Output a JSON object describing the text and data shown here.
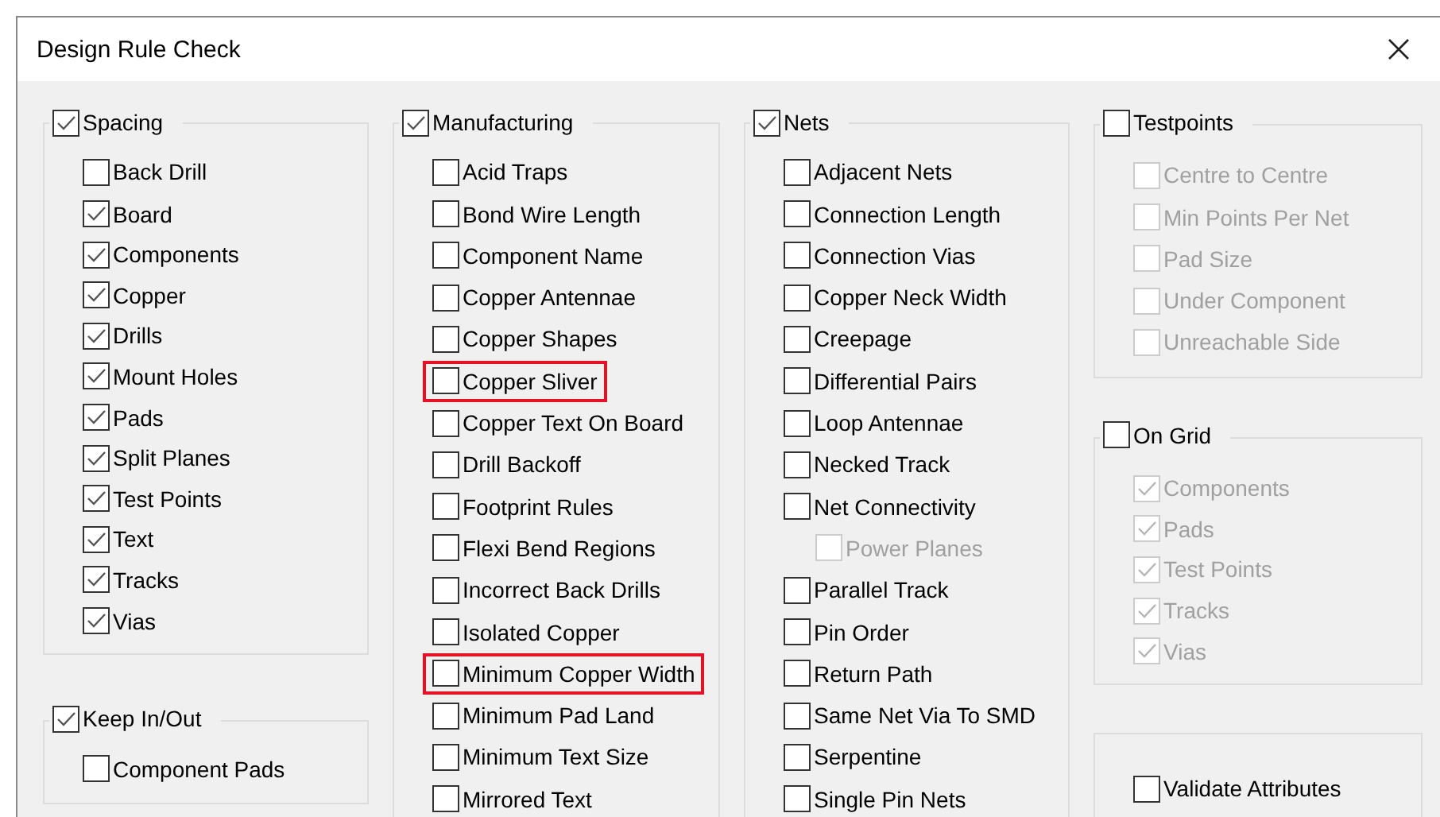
{
  "window": {
    "title": "Design Rule Check"
  },
  "columns": [
    {
      "groups": [
        {
          "title": "Spacing",
          "checked": true,
          "items": [
            {
              "label": "Back Drill",
              "checked": false
            },
            {
              "label": "Board",
              "checked": true
            },
            {
              "label": "Components",
              "checked": true
            },
            {
              "label": "Copper",
              "checked": true
            },
            {
              "label": "Drills",
              "checked": true
            },
            {
              "label": "Mount Holes",
              "checked": true
            },
            {
              "label": "Pads",
              "checked": true
            },
            {
              "label": "Split Planes",
              "checked": true
            },
            {
              "label": "Test Points",
              "checked": true
            },
            {
              "label": "Text",
              "checked": true
            },
            {
              "label": "Tracks",
              "checked": true
            },
            {
              "label": "Vias",
              "checked": true
            }
          ]
        },
        {
          "title": "Keep In/Out",
          "checked": true,
          "items": [
            {
              "label": "Component Pads",
              "checked": false
            }
          ]
        }
      ]
    },
    {
      "groups": [
        {
          "title": "Manufacturing",
          "checked": true,
          "items": [
            {
              "label": "Acid Traps",
              "checked": false,
              "highlighted": false
            },
            {
              "label": "Bond Wire Length",
              "checked": false,
              "highlighted": false
            },
            {
              "label": "Component Name",
              "checked": false,
              "highlighted": false
            },
            {
              "label": "Copper Antennae",
              "checked": false,
              "highlighted": false
            },
            {
              "label": "Copper Shapes",
              "checked": false,
              "highlighted": false
            },
            {
              "label": "Copper Sliver",
              "checked": false,
              "highlighted": true
            },
            {
              "label": "Copper Text On Board",
              "checked": false,
              "highlighted": false
            },
            {
              "label": "Drill Backoff",
              "checked": false,
              "highlighted": false
            },
            {
              "label": "Footprint Rules",
              "checked": false,
              "highlighted": false
            },
            {
              "label": "Flexi Bend Regions",
              "checked": false,
              "highlighted": false
            },
            {
              "label": "Incorrect Back Drills",
              "checked": false,
              "highlighted": false
            },
            {
              "label": "Isolated Copper",
              "checked": false,
              "highlighted": false
            },
            {
              "label": "Minimum Copper Width",
              "checked": false,
              "highlighted": true
            },
            {
              "label": "Minimum Pad Land",
              "checked": false,
              "highlighted": false
            },
            {
              "label": "Minimum Text Size",
              "checked": false,
              "highlighted": false
            },
            {
              "label": "Mirrored Text",
              "checked": false,
              "highlighted": false
            }
          ]
        }
      ]
    },
    {
      "groups": [
        {
          "title": "Nets",
          "checked": true,
          "items": [
            {
              "label": "Adjacent Nets",
              "checked": false
            },
            {
              "label": "Connection Length",
              "checked": false
            },
            {
              "label": "Connection Vias",
              "checked": false
            },
            {
              "label": "Copper Neck Width",
              "checked": false
            },
            {
              "label": "Creepage",
              "checked": false
            },
            {
              "label": "Differential Pairs",
              "checked": false
            },
            {
              "label": "Loop Antennae",
              "checked": false
            },
            {
              "label": "Necked Track",
              "checked": false
            },
            {
              "label": "Net Connectivity",
              "checked": false,
              "children": [
                {
                  "label": "Power Planes",
                  "checked": false,
                  "disabled": true
                }
              ]
            },
            {
              "label": "Parallel Track",
              "checked": false
            },
            {
              "label": "Pin Order",
              "checked": false
            },
            {
              "label": "Return Path",
              "checked": false
            },
            {
              "label": "Same Net Via To SMD",
              "checked": false
            },
            {
              "label": "Serpentine",
              "checked": false
            },
            {
              "label": "Single Pin Nets",
              "checked": false
            }
          ]
        }
      ]
    },
    {
      "groups": [
        {
          "title": "Testpoints",
          "checked": false,
          "items": [
            {
              "label": "Centre to Centre",
              "checked": false,
              "disabled": true
            },
            {
              "label": "Min Points Per Net",
              "checked": false,
              "disabled": true
            },
            {
              "label": "Pad Size",
              "checked": false,
              "disabled": true
            },
            {
              "label": "Under Component",
              "checked": false,
              "disabled": true
            },
            {
              "label": "Unreachable Side",
              "checked": false,
              "disabled": true
            }
          ]
        },
        {
          "title": "On Grid",
          "checked": false,
          "items": [
            {
              "label": "Components",
              "checked": true,
              "disabled": true
            },
            {
              "label": "Pads",
              "checked": true,
              "disabled": true
            },
            {
              "label": "Test Points",
              "checked": true,
              "disabled": true
            },
            {
              "label": "Tracks",
              "checked": true,
              "disabled": true
            },
            {
              "label": "Vias",
              "checked": true,
              "disabled": true
            }
          ]
        },
        {
          "items": [
            {
              "label": "Validate Attributes",
              "checked": false
            }
          ]
        }
      ]
    }
  ]
}
